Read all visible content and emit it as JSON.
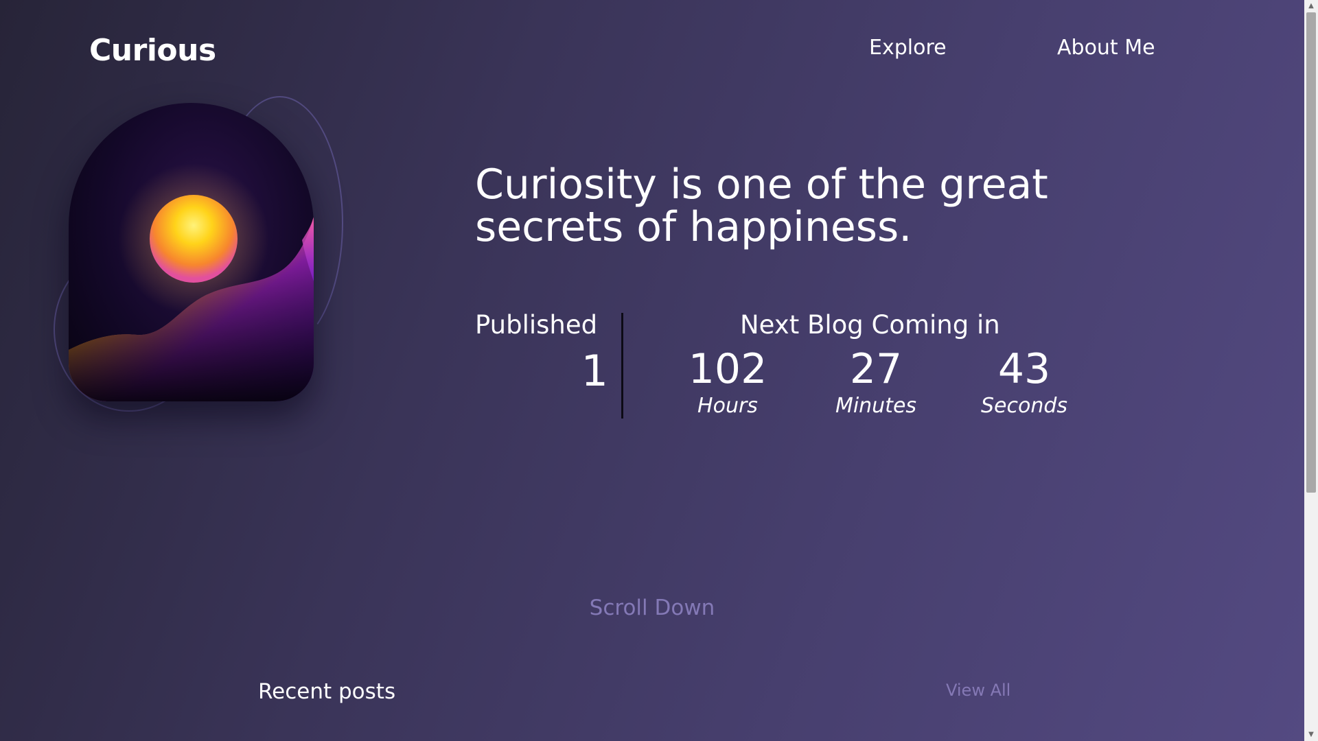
{
  "header": {
    "logo": "Curious",
    "nav": [
      {
        "label": "Explore"
      },
      {
        "label": "About Me"
      }
    ]
  },
  "hero": {
    "quote": "Curiosity is one of the great secrets of happiness.",
    "published": {
      "label": "Published",
      "value": "1"
    },
    "countdown": {
      "label": "Next Blog Coming in",
      "hours": {
        "value": "102",
        "unit": "Hours"
      },
      "minutes": {
        "value": "27",
        "unit": "Minutes"
      },
      "seconds": {
        "value": "43",
        "unit": "Seconds"
      }
    },
    "scroll_hint": "Scroll Down"
  },
  "recent": {
    "title": "Recent posts",
    "view_all": "View All"
  },
  "colors": {
    "bg_start": "#272438",
    "bg_end": "#544a82",
    "muted_link": "#8479b6",
    "sun_core": "#ffd31a",
    "sun_edge": "#e2509e",
    "wave_orange": "#ff9f1c",
    "wave_purple": "#8a1ecf"
  },
  "icons": {
    "art": "sunset-over-dunes-illustration",
    "scroll_up": "triangle-up",
    "scroll_down": "triangle-down"
  }
}
